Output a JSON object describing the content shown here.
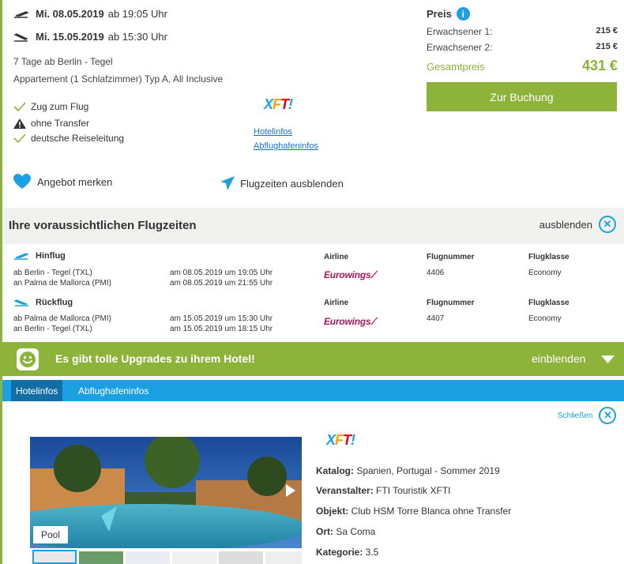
{
  "outbound": {
    "date": "Mi. 08.05.2019",
    "time": "ab 19:05 Uhr"
  },
  "inbound": {
    "date": "Mi. 15.05.2019",
    "time": "ab 15:30 Uhr"
  },
  "trip": {
    "duration": "7 Tage ab Berlin - Tegel",
    "room": "Appartement (1 Schlafzimmer) Typ A, All Inclusive"
  },
  "features": [
    {
      "icon": "check-icon",
      "label": "Zug zum Flug"
    },
    {
      "icon": "warning-icon",
      "label": "ohne Transfer"
    },
    {
      "icon": "check-icon",
      "label": "deutsche Reiseleitung"
    }
  ],
  "operator_logo": "XFTI",
  "links": {
    "hotelinfos": "Hotelinfos",
    "abflughafeninfos": "Abflughafeninfos"
  },
  "price": {
    "heading": "Preis",
    "adult1_label": "Erwachsener 1:",
    "adult1_value": "215 €",
    "adult2_label": "Erwachsener 2:",
    "adult2_value": "215 €",
    "total_label": "Gesamtpreis",
    "total_value": "431 €",
    "book_button": "Zur Buchung"
  },
  "actions": {
    "save": "Angebot merken",
    "hide_times": "Flugzeiten ausblenden"
  },
  "flight_section": {
    "title": "Ihre voraussichtlichen Flugzeiten",
    "hide_label": "ausblenden",
    "headers": {
      "airline": "Airline",
      "flight_number": "Flugnummer",
      "class": "Flugklasse"
    },
    "hinflug": {
      "label": "Hinflug",
      "dep": "ab Berlin - Tegel (TXL)",
      "dep_time": "am 08.05.2019 um 19:05 Uhr",
      "arr": "an Palma de Mallorca (PMI)",
      "arr_time": "am 08.05.2019 um 21:55 Uhr",
      "airline": "Eurowings",
      "number": "4406",
      "class": "Economy"
    },
    "rueckflug": {
      "label": "Rückflug",
      "dep": "ab Palma de Mallorca (PMI)",
      "dep_time": "am 15.05.2019 um 15:30 Uhr",
      "arr": "an Berlin - Tegel (TXL)",
      "arr_time": "am 15.05.2019 um 18:15 Uhr",
      "airline": "Eurowings",
      "number": "4407",
      "class": "Economy"
    }
  },
  "upgrade_bar": {
    "text": "Es gibt tolle Upgrades zu ihrem Hotel!",
    "toggle": "einblenden"
  },
  "tabs": [
    {
      "label": "Hotelinfos",
      "active": true
    },
    {
      "label": "Abflughafeninfos",
      "active": false
    }
  ],
  "hotel": {
    "close_label": "Schließen",
    "image_caption": "Pool",
    "details": [
      {
        "key": "Katalog:",
        "value": " Spanien, Portugal - Sommer 2019"
      },
      {
        "key": "Veranstalter:",
        "value": " FTI Touristik XFTI"
      },
      {
        "key": "Objekt:",
        "value": " Club HSM Torre Blanca ohne Transfer"
      },
      {
        "key": "Ort:",
        "value": " Sa Coma"
      },
      {
        "key": "Kategorie:",
        "value": " 3.5"
      }
    ]
  },
  "colors": {
    "green": "#8db33a",
    "blue": "#1ba1e2",
    "tab_bar": "#1ba1e2",
    "tab_active": "#116fa5"
  }
}
